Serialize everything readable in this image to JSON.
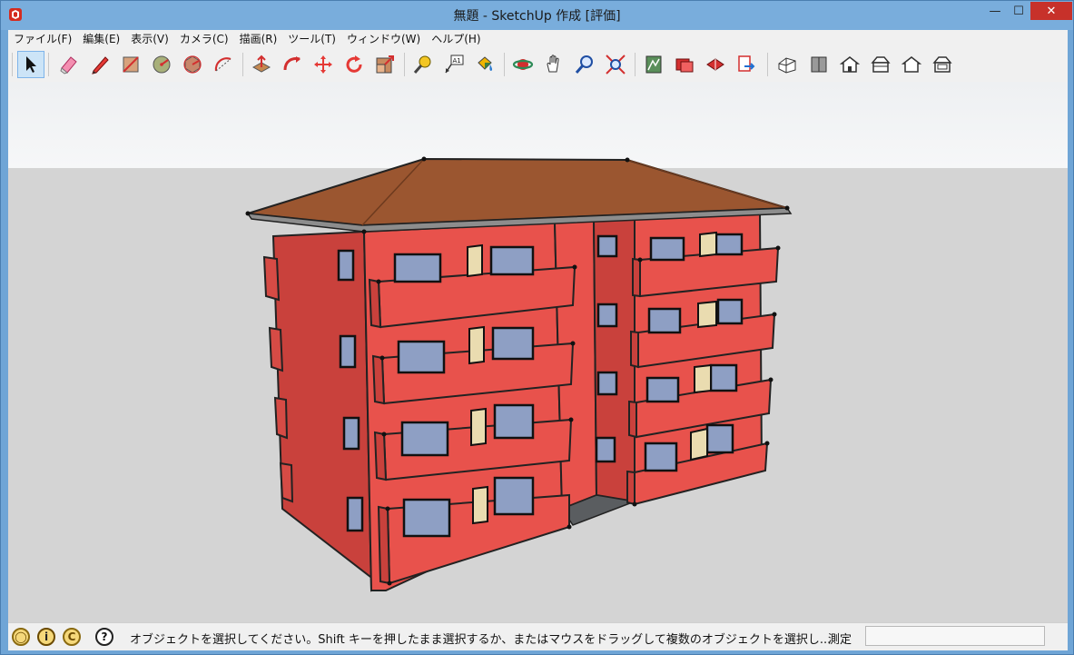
{
  "window": {
    "title": "無題 - SketchUp 作成 [評価]",
    "minimize_glyph": "—",
    "maximize_glyph": "☐",
    "close_glyph": "✕"
  },
  "menu": {
    "items": [
      "ファイル(F)",
      "編集(E)",
      "表示(V)",
      "カメラ(C)",
      "描画(R)",
      "ツール(T)",
      "ウィンドウ(W)",
      "ヘルプ(H)"
    ]
  },
  "toolbar": {
    "tools": [
      "select-tool",
      "eraser-tool",
      "line-tool",
      "rectangle-tool",
      "circle-tool",
      "polygon-tool",
      "arc-tool",
      "push-pull-tool",
      "follow-me-tool",
      "move-tool",
      "rotate-tool",
      "scale-tool",
      "tape-measure-tool",
      "text-tool",
      "paint-bucket-tool",
      "orbit-tool",
      "pan-tool",
      "zoom-tool",
      "zoom-extents-tool",
      "warehouse-tool",
      "extension-tool",
      "share-model-tool",
      "send-to-layout-tool",
      "iso-view",
      "top-view",
      "front-view",
      "right-view",
      "back-view",
      "left-view"
    ],
    "active_tool": "select-tool",
    "text_tool_glyph": "A1"
  },
  "colors": {
    "wall": "#e8524c",
    "wall_shade": "#c9413c",
    "roof": "#9b5630",
    "glass": "#8e9fc4",
    "door": "#eadcb0"
  },
  "status": {
    "hint": "オブジェクトを選択してください。Shift キーを押したまま選択するか、またはマウスをドラッグして複数のオブジェクトを選択し...",
    "measurements_label": "測定",
    "measurements_value": "",
    "help_glyph": "?"
  }
}
